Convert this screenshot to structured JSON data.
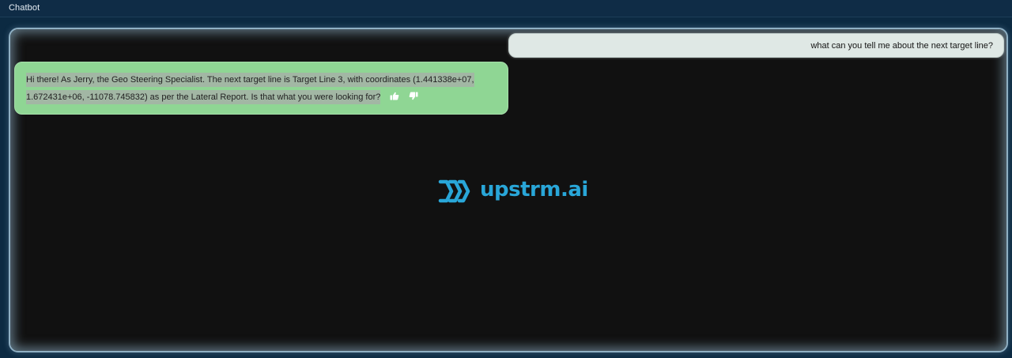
{
  "header": {
    "title": "Chatbot"
  },
  "messages": {
    "user": {
      "text": "what can you tell me about the next target line?"
    },
    "bot": {
      "line1": "Hi there! As Jerry, the Geo Steering Specialist. The next target line is Target Line 3, with coordinates (1.441338e+07,",
      "line2": "1.672431e+06, -11078.745832) as per the Lateral Report. Is that what you were looking for?"
    }
  },
  "feedback": {
    "like_icon": "thumbs-up-icon",
    "dislike_icon": "thumbs-down-icon"
  },
  "logo": {
    "text": "upstrm.ai",
    "color": "#29a6d8"
  },
  "colors": {
    "background": "#0c2a42",
    "panel": "#111111",
    "user_bubble": "#dfe8e5",
    "bot_bubble": "#8fd694"
  }
}
